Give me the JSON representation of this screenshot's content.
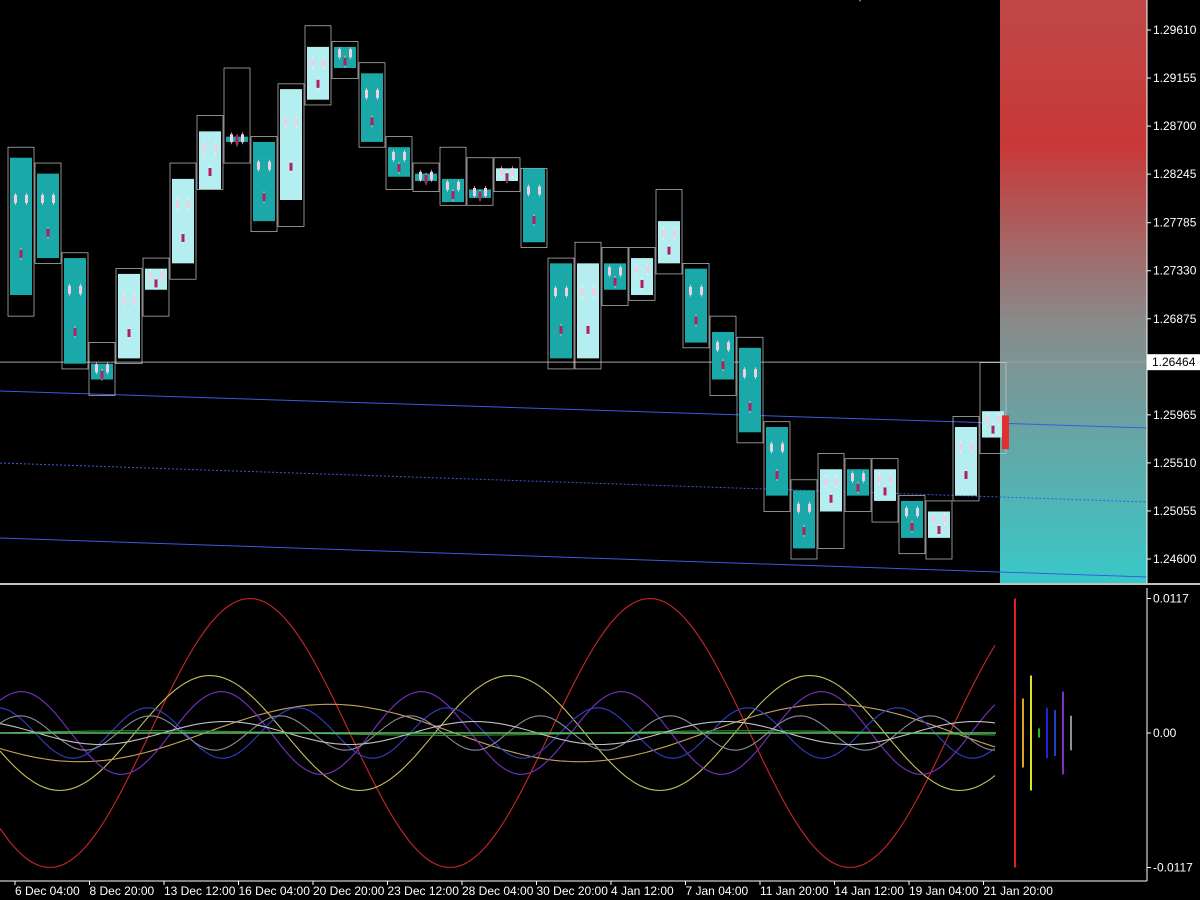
{
  "chart_data": [
    {
      "type": "candlestick",
      "title": "",
      "current_price": "1.26464",
      "price_axis": {
        "ticks": [
          "1.29610",
          "1.29155",
          "1.28700",
          "1.28245",
          "1.27785",
          "1.27330",
          "1.26875",
          "1.26464",
          "1.25965",
          "1.25510",
          "1.25055",
          "1.24600"
        ],
        "ylim": [
          1.2432,
          1.2984
        ]
      },
      "time_axis": {
        "ticks": [
          "6 Dec 04:00",
          "8 Dec 20:00",
          "13 Dec 12:00",
          "16 Dec 04:00",
          "20 Dec 20:00",
          "23 Dec 12:00",
          "28 Dec 04:00",
          "30 Dec 20:00",
          "4 Jan 12:00",
          "7 Jan 04:00",
          "11 Jan 20:00",
          "14 Jan 12:00",
          "19 Jan 04:00",
          "21 Jan 20:00"
        ]
      },
      "bars": [
        {
          "o": 1.284,
          "c": 1.271,
          "h": 1.285,
          "l": 1.269
        },
        {
          "o": 1.2825,
          "c": 1.2745,
          "h": 1.2835,
          "l": 1.274
        },
        {
          "o": 1.2745,
          "c": 1.2645,
          "h": 1.275,
          "l": 1.264
        },
        {
          "o": 1.2645,
          "c": 1.263,
          "h": 1.2665,
          "l": 1.2615
        },
        {
          "o": 1.265,
          "c": 1.273,
          "h": 1.2735,
          "l": 1.2645
        },
        {
          "o": 1.2715,
          "c": 1.2735,
          "h": 1.2745,
          "l": 1.269
        },
        {
          "o": 1.274,
          "c": 1.282,
          "h": 1.2835,
          "l": 1.2725
        },
        {
          "o": 1.281,
          "c": 1.2865,
          "h": 1.288,
          "l": 1.281
        },
        {
          "o": 1.286,
          "c": 1.2855,
          "h": 1.2925,
          "l": 1.2835
        },
        {
          "o": 1.2855,
          "c": 1.278,
          "h": 1.286,
          "l": 1.277
        },
        {
          "o": 1.28,
          "c": 1.2905,
          "h": 1.291,
          "l": 1.2775
        },
        {
          "o": 1.2895,
          "c": 1.2945,
          "h": 1.2965,
          "l": 1.289
        },
        {
          "o": 1.2945,
          "c": 1.2925,
          "h": 1.295,
          "l": 1.2915
        },
        {
          "o": 1.292,
          "c": 1.2855,
          "h": 1.293,
          "l": 1.285
        },
        {
          "o": 1.285,
          "c": 1.2822,
          "h": 1.286,
          "l": 1.281
        },
        {
          "o": 1.2825,
          "c": 1.2818,
          "h": 1.2835,
          "l": 1.2808
        },
        {
          "o": 1.282,
          "c": 1.2798,
          "h": 1.285,
          "l": 1.2795
        },
        {
          "o": 1.281,
          "c": 1.2802,
          "h": 1.284,
          "l": 1.2795
        },
        {
          "o": 1.2818,
          "c": 1.283,
          "h": 1.284,
          "l": 1.2808
        },
        {
          "o": 1.283,
          "c": 1.276,
          "h": 1.283,
          "l": 1.2755
        },
        {
          "o": 1.274,
          "c": 1.265,
          "h": 1.2745,
          "l": 1.264
        },
        {
          "o": 1.265,
          "c": 1.274,
          "h": 1.276,
          "l": 1.264
        },
        {
          "o": 1.274,
          "c": 1.2715,
          "h": 1.2755,
          "l": 1.27
        },
        {
          "o": 1.271,
          "c": 1.2745,
          "h": 1.2755,
          "l": 1.2705
        },
        {
          "o": 1.274,
          "c": 1.278,
          "h": 1.281,
          "l": 1.273
        },
        {
          "o": 1.2735,
          "c": 1.2665,
          "h": 1.274,
          "l": 1.266
        },
        {
          "o": 1.2675,
          "c": 1.263,
          "h": 1.269,
          "l": 1.2615
        },
        {
          "o": 1.266,
          "c": 1.258,
          "h": 1.267,
          "l": 1.257
        },
        {
          "o": 1.2585,
          "c": 1.252,
          "h": 1.259,
          "l": 1.2505
        },
        {
          "o": 1.2525,
          "c": 1.247,
          "h": 1.2535,
          "l": 1.246
        },
        {
          "o": 1.2505,
          "c": 1.2545,
          "h": 1.256,
          "l": 1.247
        },
        {
          "o": 1.2545,
          "c": 1.252,
          "h": 1.2555,
          "l": 1.2505
        },
        {
          "o": 1.2515,
          "c": 1.2545,
          "h": 1.2555,
          "l": 1.2495
        },
        {
          "o": 1.2515,
          "c": 1.248,
          "h": 1.252,
          "l": 1.2465
        },
        {
          "o": 1.248,
          "c": 1.2505,
          "h": 1.2515,
          "l": 1.246
        },
        {
          "o": 1.252,
          "c": 1.2585,
          "h": 1.2595,
          "l": 1.2515
        },
        {
          "o": 1.2575,
          "c": 1.26,
          "h": 1.2646,
          "l": 1.256
        }
      ]
    },
    {
      "type": "line",
      "title": "",
      "y_axis": {
        "ticks": [
          "0.0117",
          "0.00",
          "-0.0117"
        ],
        "ylim": [
          -0.0117,
          0.0117
        ]
      },
      "series": [
        {
          "color": "#c82828",
          "amp": 0.0117,
          "period": 400,
          "phase": 3.93
        },
        {
          "color": "#c8c060",
          "amp": 0.005,
          "period": 300,
          "phase": 3.46
        },
        {
          "color": "#c8a060",
          "amp": 0.0025,
          "period": 500,
          "phase": 3.71
        },
        {
          "color": "#7a30c0",
          "amp": 0.0036,
          "period": 200,
          "phase": 0.91
        },
        {
          "color": "#3040c8",
          "amp": 0.0022,
          "period": 150,
          "phase": 1.67
        },
        {
          "color": "#8a8a9a",
          "amp": 0.0015,
          "period": 130,
          "phase": 0.6
        },
        {
          "color": "#3c8c3c",
          "amp": 0.0002,
          "period": 600,
          "phase": 0.0
        },
        {
          "color": "#c0c0c0",
          "amp": 0.001,
          "period": 250,
          "phase": 2.2
        }
      ],
      "spectrum": [
        {
          "color": "#e02020",
          "value": 0.0117
        },
        {
          "color": "#e0a020",
          "value": 0.003
        },
        {
          "color": "#e0e020",
          "value": 0.005
        },
        {
          "color": "#20c020",
          "value": 0.0004
        },
        {
          "color": "#2020e0",
          "value": 0.0022
        },
        {
          "color": "#2040c0",
          "value": 0.002
        },
        {
          "color": "#8030c0",
          "value": 0.0036
        },
        {
          "color": "#909090",
          "value": 0.0015
        }
      ]
    }
  ]
}
